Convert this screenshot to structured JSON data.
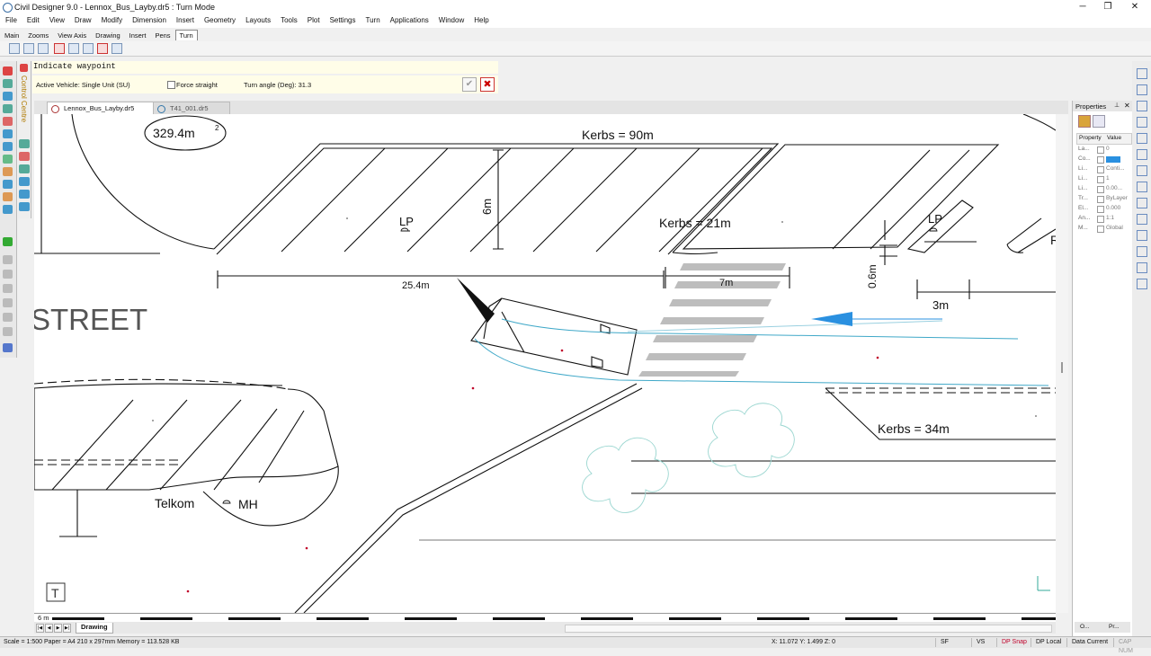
{
  "window": {
    "title": "Civil Designer 9.0 - Lennox_Bus_Layby.dr5 : Turn Mode"
  },
  "menu": [
    "File",
    "Edit",
    "View",
    "Draw",
    "Modify",
    "Dimension",
    "Insert",
    "Geometry",
    "Layouts",
    "Tools",
    "Plot",
    "Settings",
    "Turn",
    "Applications",
    "Window",
    "Help"
  ],
  "ribbon_tabs": [
    "Main",
    "Zooms",
    "View Axis",
    "Drawing",
    "Insert",
    "Pens",
    "Turn"
  ],
  "ribbon_active": "Turn",
  "control_centre_label": "Control Centre",
  "prompt": "Indicate waypoint",
  "command_bar": {
    "active_vehicle": "Active Vehicle: Single Unit (SU)",
    "force_straight": "Force straight",
    "turn_angle": "Turn angle (Deg): 31.3"
  },
  "doc_tabs": [
    {
      "label": "Lennox_Bus_Layby.dr5",
      "active": true,
      "close": "×"
    },
    {
      "label": "T41_001.dr5",
      "active": false
    }
  ],
  "drawing": {
    "area_label": "329.4m",
    "area_sup": "2",
    "kerbs_90": "Kerbs = 90m",
    "kerbs_21": "Kerbs = 21m",
    "kerbs_34": "Kerbs = 34m",
    "lp1": "LP",
    "lp2": "LP",
    "dim_6m": "6m",
    "dim_25": "25.4m",
    "dim_7m": "7m",
    "dim_06": "0.6m",
    "dim_3m": "3m",
    "street": "STREET",
    "telkom": "Telkom",
    "mh": "MH",
    "partial_r": "R",
    "text_tool": "T"
  },
  "ruler_label": "6 m",
  "sheet_tab": "Drawing",
  "properties": {
    "title": "Properties",
    "col_property": "Property",
    "col_value": "Value",
    "rows": [
      {
        "name": "La...",
        "value": "0"
      },
      {
        "name": "Co...",
        "value": ""
      },
      {
        "name": "Li...",
        "value": "Conti..."
      },
      {
        "name": "Li...",
        "value": "1"
      },
      {
        "name": "Li...",
        "value": "0.00..."
      },
      {
        "name": "Tr...",
        "value": "ByLayer"
      },
      {
        "name": "El...",
        "value": "0.000"
      },
      {
        "name": "An...",
        "value": "1:1"
      },
      {
        "name": "M...",
        "value": "Global"
      }
    ],
    "bottom_tabs": [
      "O...",
      "Pr..."
    ]
  },
  "status": {
    "left": "Scale = 1:500  Paper = A4 210 x 297mm  Memory = 113.528 KB",
    "coords": "X: 11.072 Y: 1.499 Z: 0",
    "buttons": [
      "SF",
      "VS",
      "DP Snap",
      "DP Local",
      "Data Current",
      "CAP NUM"
    ]
  },
  "colors": {
    "accent_blue": "#2a90e0",
    "path_cyan": "#3fa8c8",
    "cancel_red": "#cc0000",
    "snap_red": "#c0002a"
  }
}
